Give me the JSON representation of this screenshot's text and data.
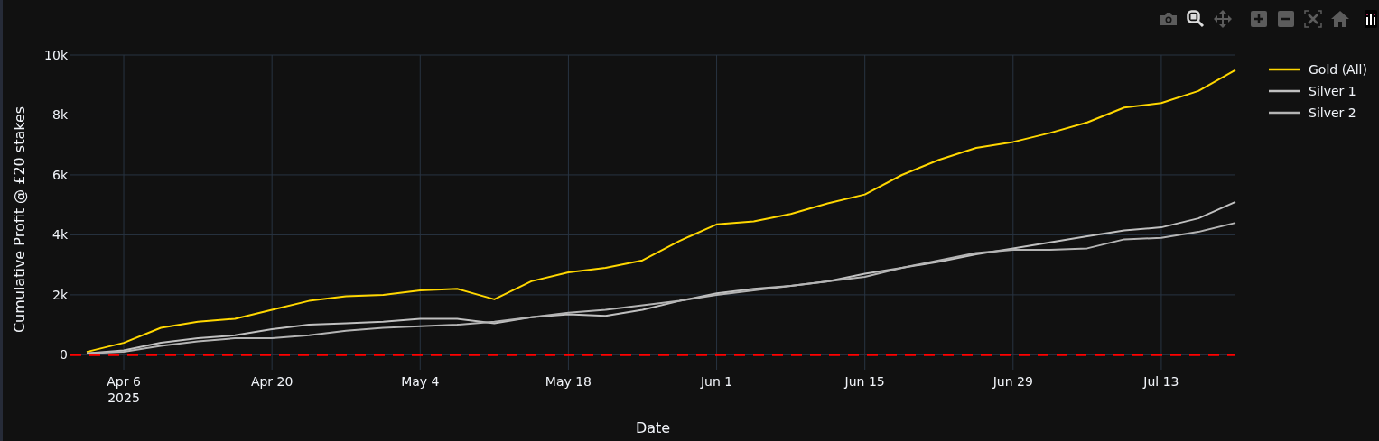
{
  "modebar": [
    {
      "kind": "camera",
      "selected": false
    },
    {
      "kind": "zoom",
      "selected": true
    },
    {
      "kind": "pan",
      "selected": false
    },
    {
      "kind": "zoom-in",
      "selected": false
    },
    {
      "kind": "zoom-out",
      "selected": false
    },
    {
      "kind": "autoscale",
      "selected": false
    },
    {
      "kind": "home",
      "selected": false
    }
  ],
  "chart": {
    "chart_data": {
      "type": "line",
      "xlabel": "Date",
      "ylabel": "Cumulative Profit @ £20 stakes",
      "categories": [
        null,
        "Apr 6\n2025",
        null,
        null,
        null,
        "Apr 20",
        null,
        null,
        null,
        "May 4",
        null,
        null,
        null,
        "May 18",
        null,
        null,
        null,
        "Jun 1",
        null,
        null,
        null,
        "Jun 15",
        null,
        null,
        null,
        "Jun 29",
        null,
        null,
        null,
        "Jul 13",
        null,
        null
      ],
      "series": [
        {
          "name": "Gold (All)",
          "color": "#ffd700",
          "values": [
            100,
            400,
            900,
            1100,
            1200,
            1500,
            1800,
            1950,
            2000,
            2150,
            2200,
            1850,
            2450,
            2750,
            2900,
            3150,
            3800,
            4350,
            4450,
            4700,
            5050,
            5350,
            6000,
            6500,
            6900,
            7100,
            7400,
            7750,
            8250,
            8400,
            8800,
            9500
          ]
        },
        {
          "name": "Silver 1",
          "color": "#c0c0c0",
          "values": [
            50,
            150,
            400,
            550,
            650,
            850,
            1000,
            1050,
            1100,
            1200,
            1200,
            1050,
            1250,
            1350,
            1300,
            1500,
            1800,
            2050,
            2200,
            2300,
            2450,
            2700,
            2900,
            3100,
            3350,
            3550,
            3750,
            3950,
            4150,
            4250,
            4550,
            5100
          ]
        },
        {
          "name": "Silver 2",
          "color": "#b4b4b4",
          "values": [
            50,
            100,
            300,
            450,
            550,
            550,
            650,
            800,
            900,
            950,
            1000,
            1100,
            1250,
            1400,
            1500,
            1650,
            1800,
            2000,
            2150,
            2300,
            2450,
            2600,
            2900,
            3150,
            3400,
            3500,
            3500,
            3550,
            3850,
            3900,
            4100,
            4400
          ]
        }
      ],
      "ylim": [
        -500,
        10000
      ],
      "grid": true,
      "legend": "right",
      "yticks": [
        {
          "value": 0,
          "label": "0"
        },
        {
          "value": 2000,
          "label": "2k"
        },
        {
          "value": 4000,
          "label": "4k"
        },
        {
          "value": 6000,
          "label": "6k"
        },
        {
          "value": 8000,
          "label": "8k"
        },
        {
          "value": 10000,
          "label": "10k"
        }
      ],
      "ref_lines": [
        {
          "axis": "y",
          "value": 0,
          "color": "#ff0000"
        }
      ]
    }
  }
}
